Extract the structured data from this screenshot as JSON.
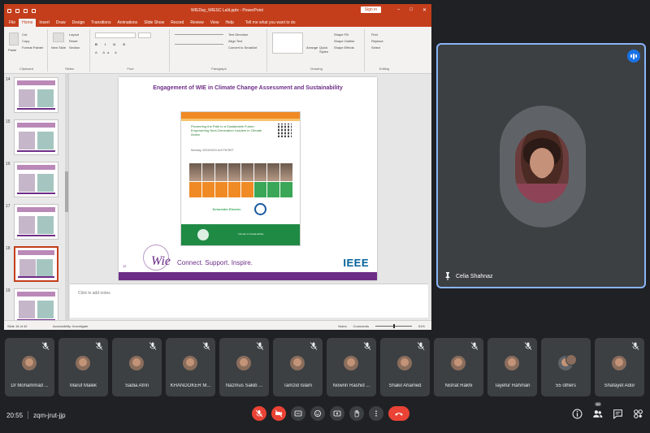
{
  "ppt": {
    "title_doc": "WIEDay_WIESC Lalit.pptx  -  PowerPoint",
    "sign_in": "Sign in",
    "tabs": [
      "File",
      "Home",
      "Insert",
      "Draw",
      "Design",
      "Transitions",
      "Animations",
      "Slide Show",
      "Record",
      "Review",
      "View",
      "Help"
    ],
    "active_tab": "Home",
    "tell_me": "Tell me what you want to do",
    "ribbon": {
      "clipboard": {
        "paste": "Paste",
        "cut": "Cut",
        "copy": "Copy",
        "format_painter": "Format Painter",
        "label": "Clipboard"
      },
      "slides": {
        "new_slide": "New Slide",
        "layout": "Layout",
        "reset": "Reset",
        "section": "Section",
        "label": "Slides"
      },
      "font_label": "Font",
      "paragraph": {
        "text_direction": "Text Direction",
        "align_text": "Align Text",
        "convert": "Convert to SmartArt",
        "label": "Paragraph"
      },
      "drawing": {
        "arrange": "Arrange",
        "quick_styles": "Quick Styles",
        "shape_fill": "Shape Fill",
        "shape_outline": "Shape Outline",
        "shape_effects": "Shape Effects",
        "label": "Drawing"
      },
      "editing": {
        "find": "Find",
        "replace": "Replace",
        "select": "Select",
        "label": "Editing"
      }
    },
    "thumb_numbers": [
      "14",
      "15",
      "16",
      "17",
      "18",
      "19"
    ],
    "slide": {
      "title": "Engagement of WIE in Climate Change Assessment and Sustainability",
      "inner_heading": "Pioneering the Path to a Sustainable Future: Empowering Next-Generation Leaders in Climate Action",
      "inner_date": "Monday, 2024/04/15 at 6 PM BST",
      "logo_text": "Schneider Electric",
      "footer_text": "Climate & Sustainability",
      "wie_mark": "Wie",
      "slide_num": "12",
      "tagline": "Connect. Support. Inspire.",
      "ieee": "IEEE"
    },
    "notes_placeholder": "Click to add notes",
    "status": {
      "slide_of": "Slide 18 of 42",
      "accessibility": "Accessibility: Investigate",
      "notes": "Notes",
      "comments": "Comments",
      "zoom": "51%"
    }
  },
  "pinned": {
    "name": "Celia Shahnaz"
  },
  "participants": [
    {
      "name": "Dr Mohammad ..."
    },
    {
      "name": "Maruf Malek"
    },
    {
      "name": "Sadia Afrin"
    },
    {
      "name": "KHANDOKER M..."
    },
    {
      "name": "Nazmus Sakib ..."
    },
    {
      "name": "Tamzid Islam"
    },
    {
      "name": "Nowrin Rashid ..."
    },
    {
      "name": "Shakil Ahamed"
    },
    {
      "name": "Nishat Rakhi"
    },
    {
      "name": "Tayefur Rahman"
    },
    {
      "name": "55 others"
    },
    {
      "name": "Shafayet Ador"
    }
  ],
  "bar": {
    "time": "20:55",
    "meeting_code": "zqm-jrut-jjp",
    "people_count": "69"
  },
  "colors": {
    "accent_red": "#ea4335",
    "ppt_brand": "#c43e1c",
    "meet_bg": "#202124",
    "tile_bg": "#3c4043",
    "pinned_border": "#8ab4f8",
    "wie_purple": "#6c2d86"
  }
}
